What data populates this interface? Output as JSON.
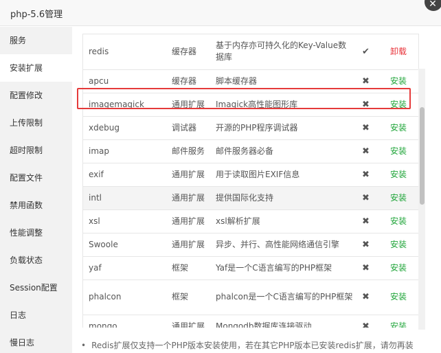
{
  "window": {
    "title": "php-5.6管理",
    "close_glyph": "✕"
  },
  "sidebar": {
    "items": [
      {
        "label": "服务"
      },
      {
        "label": "安装扩展",
        "active": true
      },
      {
        "label": "配置修改"
      },
      {
        "label": "上传限制"
      },
      {
        "label": "超时限制"
      },
      {
        "label": "配置文件"
      },
      {
        "label": "禁用函数"
      },
      {
        "label": "性能调整"
      },
      {
        "label": "负载状态"
      },
      {
        "label": "Session配置"
      },
      {
        "label": "日志"
      },
      {
        "label": "慢日志"
      }
    ]
  },
  "extensions": {
    "rows": [
      {
        "name": "redis",
        "type": "缓存器",
        "desc": "基于内存亦可持久化的Key-Value数据库",
        "status": "✔",
        "status_icon": "check-icon",
        "action": "卸载",
        "action_kind": "uninstall"
      },
      {
        "name": "apcu",
        "type": "缓存器",
        "desc": "脚本缓存器",
        "status": "✖",
        "status_icon": "cross-icon",
        "action": "安装",
        "action_kind": "install"
      },
      {
        "name": "imagemagick",
        "type": "通用扩展",
        "desc": "Imagick高性能图形库",
        "status": "✖",
        "status_icon": "cross-icon",
        "action": "安装",
        "action_kind": "install"
      },
      {
        "name": "xdebug",
        "type": "调试器",
        "desc": "开源的PHP程序调试器",
        "status": "✖",
        "status_icon": "cross-icon",
        "action": "安装",
        "action_kind": "install"
      },
      {
        "name": "imap",
        "type": "邮件服务",
        "desc": "邮件服务器必备",
        "status": "✖",
        "status_icon": "cross-icon",
        "action": "安装",
        "action_kind": "install"
      },
      {
        "name": "exif",
        "type": "通用扩展",
        "desc": "用于读取图片EXIF信息",
        "status": "✖",
        "status_icon": "cross-icon",
        "action": "安装",
        "action_kind": "install"
      },
      {
        "name": "intl",
        "type": "通用扩展",
        "desc": "提供国际化支持",
        "status": "✖",
        "status_icon": "cross-icon",
        "action": "安装",
        "action_kind": "install"
      },
      {
        "name": "xsl",
        "type": "通用扩展",
        "desc": "xsl解析扩展",
        "status": "✖",
        "status_icon": "cross-icon",
        "action": "安装",
        "action_kind": "install"
      },
      {
        "name": "Swoole",
        "type": "通用扩展",
        "desc": "异步、并行、高性能网络通信引擎",
        "status": "✖",
        "status_icon": "cross-icon",
        "action": "安装",
        "action_kind": "install"
      },
      {
        "name": "yaf",
        "type": "框架",
        "desc": "Yaf是一个C语言编写的PHP框架",
        "status": "✖",
        "status_icon": "cross-icon",
        "action": "安装",
        "action_kind": "install"
      },
      {
        "name": "phalcon",
        "type": "框架",
        "desc": "phalcon是一个C语言编写的PHP框架",
        "status": "✖",
        "status_icon": "cross-icon",
        "action": "安装",
        "action_kind": "install"
      },
      {
        "name": "mongo",
        "type": "通用扩展",
        "desc": "Mongodb数据库连接驱动",
        "status": "✖",
        "status_icon": "cross-icon",
        "action": "安装",
        "action_kind": "install"
      }
    ]
  },
  "note": {
    "bullet": "•",
    "text": "Redis扩展仅支持一个PHP版本安装使用，若在其它PHP版本已安装redis扩展，请勿再装"
  },
  "colors": {
    "install": "#20a53a",
    "uninstall": "#e8333a",
    "highlight": "#e53a3a"
  }
}
